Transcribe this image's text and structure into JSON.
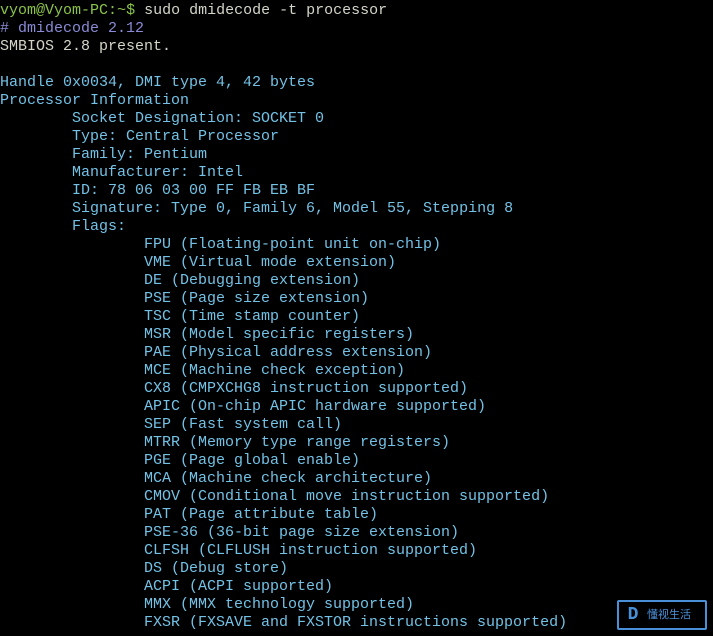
{
  "prompt": {
    "user_host": "vyom@Vyom-PC",
    "sep": ":",
    "path": "~",
    "sigil": "$ ",
    "command": "sudo dmidecode -t processor"
  },
  "preamble": {
    "version": "# dmidecode 2.12",
    "smbios": "SMBIOS 2.8 present."
  },
  "handle": "Handle 0x0034, DMI type 4, 42 bytes",
  "section_title": "Processor Information",
  "fields": {
    "socket": "Socket Designation: SOCKET 0",
    "type": "Type: Central Processor",
    "family": "Family: Pentium",
    "manufacturer": "Manufacturer: Intel",
    "id": "ID: 78 06 03 00 FF FB EB BF",
    "signature": "Signature: Type 0, Family 6, Model 55, Stepping 8",
    "flags_label": "Flags:"
  },
  "flags": [
    "FPU (Floating-point unit on-chip)",
    "VME (Virtual mode extension)",
    "DE (Debugging extension)",
    "PSE (Page size extension)",
    "TSC (Time stamp counter)",
    "MSR (Model specific registers)",
    "PAE (Physical address extension)",
    "MCE (Machine check exception)",
    "CX8 (CMPXCHG8 instruction supported)",
    "APIC (On-chip APIC hardware supported)",
    "SEP (Fast system call)",
    "MTRR (Memory type range registers)",
    "PGE (Page global enable)",
    "MCA (Machine check architecture)",
    "CMOV (Conditional move instruction supported)",
    "PAT (Page attribute table)",
    "PSE-36 (36-bit page size extension)",
    "CLFSH (CLFLUSH instruction supported)",
    "DS (Debug store)",
    "ACPI (ACPI supported)",
    "MMX (MMX technology supported)",
    "FXSR (FXSAVE and FXSTOR instructions supported)"
  ],
  "watermark": {
    "icon": "D",
    "text": "懂视生活"
  }
}
